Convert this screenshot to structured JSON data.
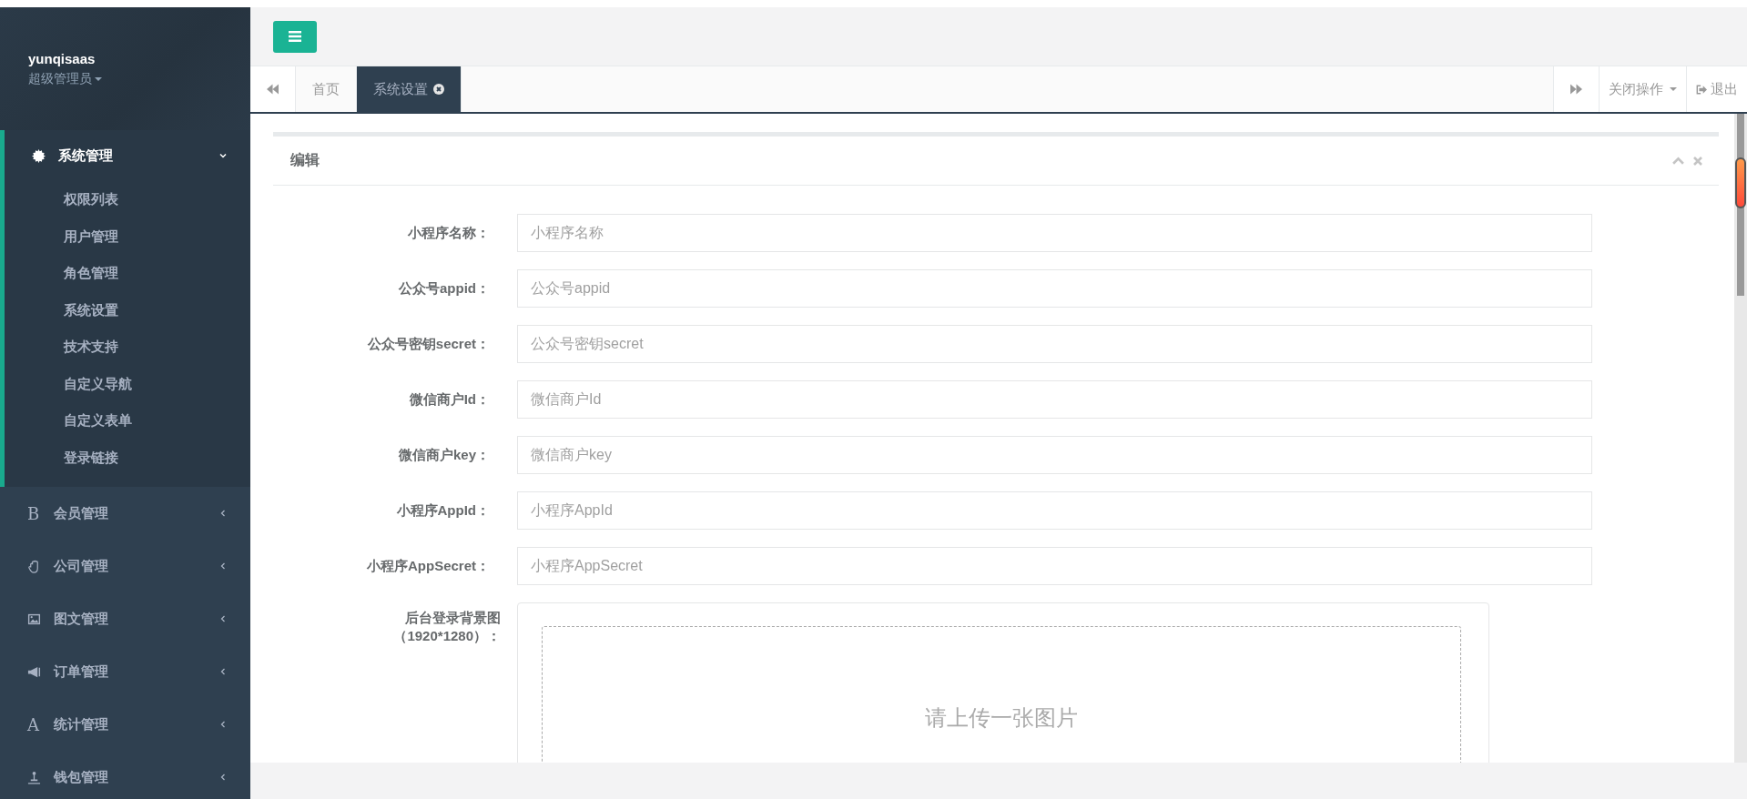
{
  "profile": {
    "name": "yunqisaas",
    "role": "超级管理员"
  },
  "menu": [
    {
      "label": "系统管理",
      "expanded": true,
      "children": [
        {
          "label": "权限列表"
        },
        {
          "label": "用户管理"
        },
        {
          "label": "角色管理"
        },
        {
          "label": "系统设置"
        },
        {
          "label": "技术支持"
        },
        {
          "label": "自定义导航"
        },
        {
          "label": "自定义表单"
        },
        {
          "label": "登录链接"
        }
      ]
    },
    {
      "label": "会员管理",
      "expanded": false,
      "glyph": "B"
    },
    {
      "label": "公司管理",
      "expanded": false
    },
    {
      "label": "图文管理",
      "expanded": false
    },
    {
      "label": "订单管理",
      "expanded": false
    },
    {
      "label": "统计管理",
      "expanded": false,
      "glyph": "A"
    },
    {
      "label": "钱包管理",
      "expanded": false
    }
  ],
  "tabs": [
    {
      "label": "首页",
      "selected": false,
      "closable": false
    },
    {
      "label": "系统设置",
      "selected": true,
      "closable": true
    }
  ],
  "close_menu": "关闭操作",
  "logout": "退出",
  "panel": {
    "title": "编辑",
    "fields": [
      {
        "label": "小程序名称：",
        "placeholder": "小程序名称"
      },
      {
        "label": "公众号appid：",
        "placeholder": "公众号appid"
      },
      {
        "label": "公众号密钥secret：",
        "placeholder": "公众号密钥secret"
      },
      {
        "label": "微信商户Id：",
        "placeholder": "微信商户Id"
      },
      {
        "label": "微信商户key：",
        "placeholder": "微信商户key"
      },
      {
        "label": "小程序AppId：",
        "placeholder": "小程序AppId"
      },
      {
        "label": "小程序AppSecret：",
        "placeholder": "小程序AppSecret"
      }
    ],
    "upload": {
      "label_lines": [
        "后台登录背景图",
        "（1920*1280）："
      ],
      "hint": "请上传一张图片"
    }
  }
}
